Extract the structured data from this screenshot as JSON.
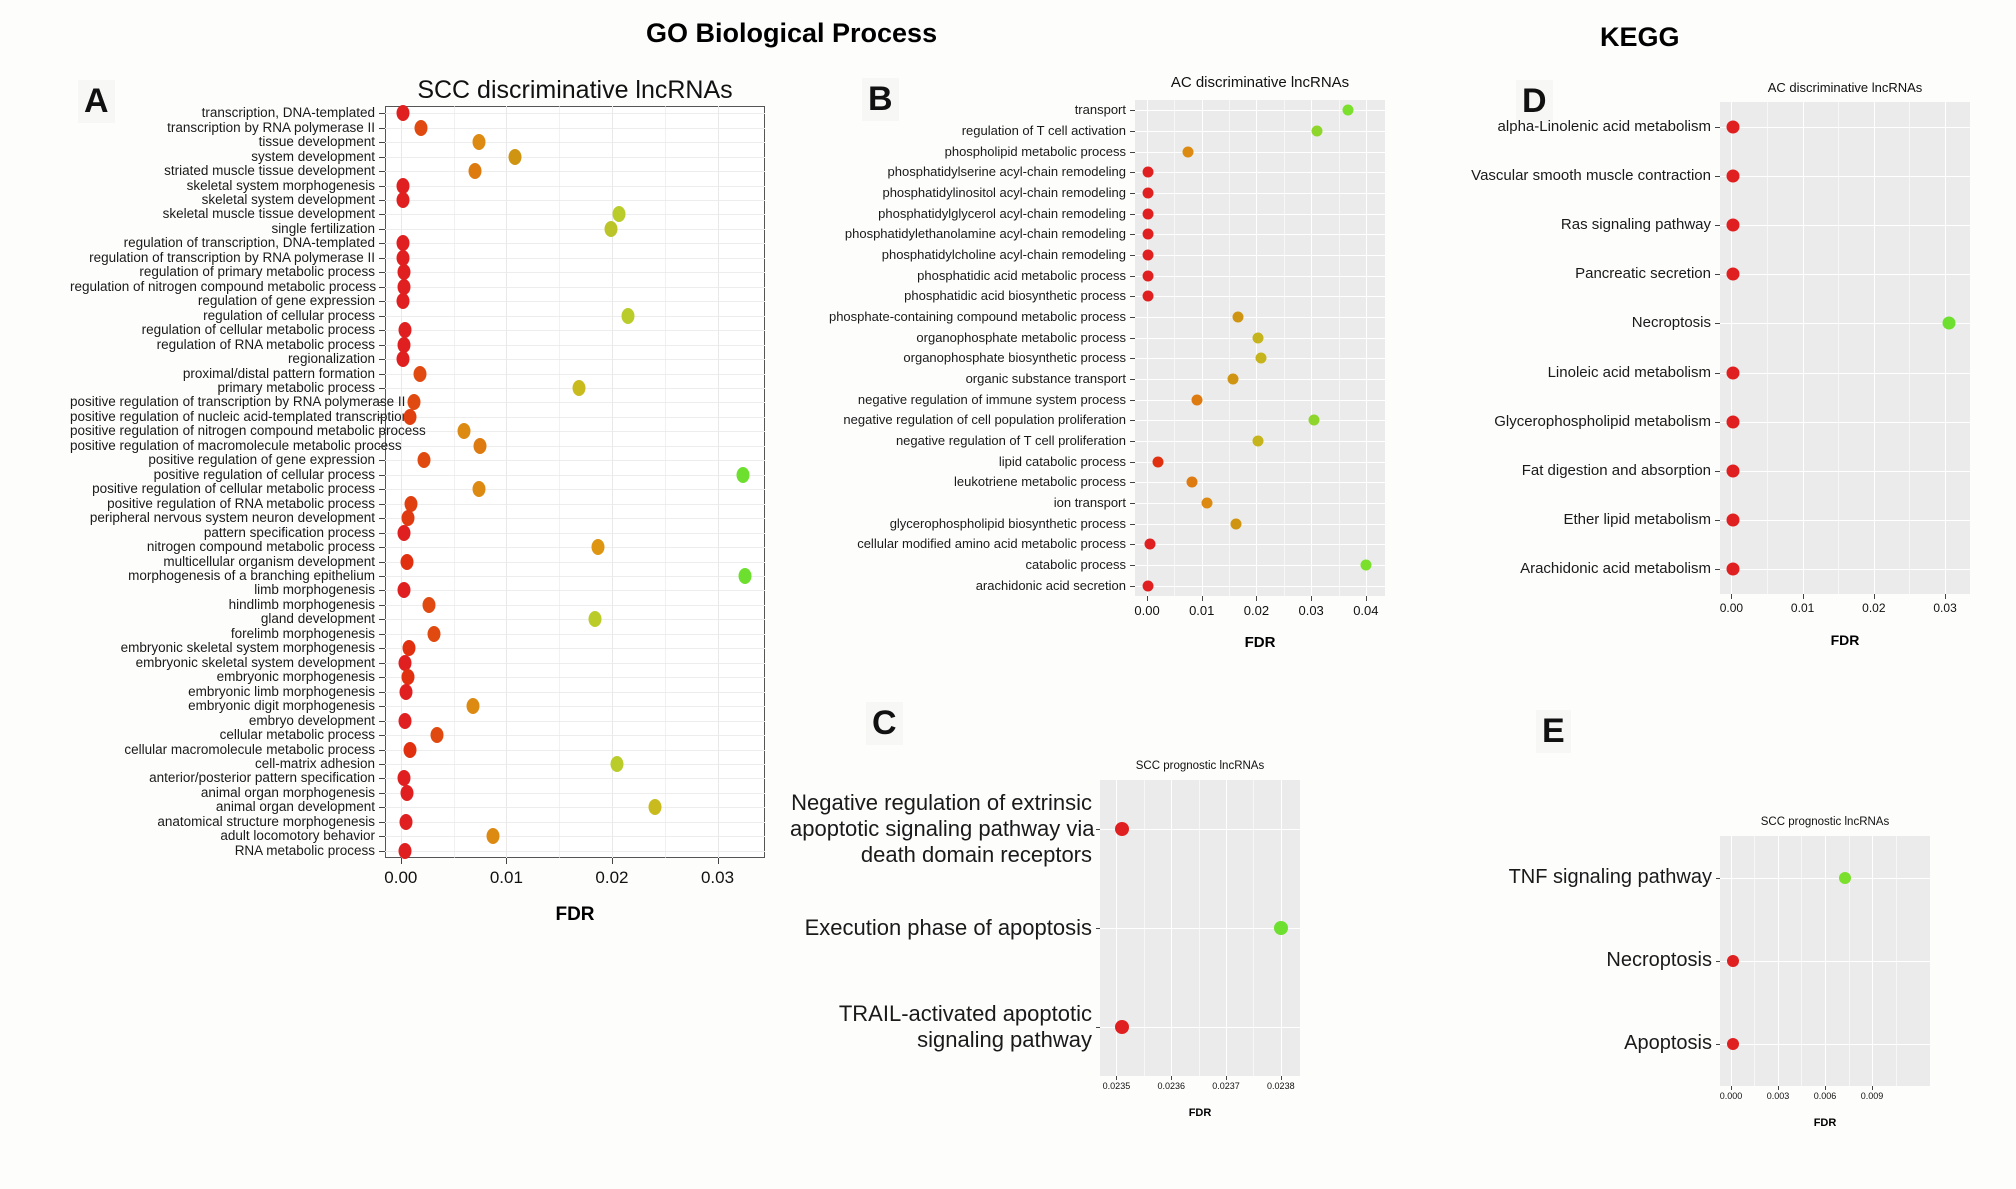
{
  "figure": {
    "suptitles": {
      "go": "GO Biological Process",
      "kegg": "KEGG"
    },
    "panel_letters": {
      "a": "A",
      "b": "B",
      "c": "C",
      "d": "D",
      "e": "E"
    },
    "axis_label": "FDR",
    "colors": {
      "red": "#e02020",
      "orange_red": "#e04a10",
      "orange": "#dd7a10",
      "amber": "#cf9512",
      "olive": "#bbb022",
      "yellow_green": "#b9cc2a",
      "green": "#6ddf2e",
      "bright_green": "#5ef52a",
      "panel_grey": "#ebebeb",
      "grid_white": "#ffffff"
    }
  },
  "chart_data": [
    {
      "id": "A",
      "type": "scatter",
      "title": "SCC discriminative lncRNAs",
      "xlabel": "FDR",
      "ylabel": "",
      "xlim": [
        -0.0015,
        0.0345
      ],
      "xticks": [
        0.0,
        0.01,
        0.02,
        0.03
      ],
      "xtick_labels": [
        "0.00",
        "0.01",
        "0.02",
        "0.03"
      ],
      "grid": true,
      "legend": "none",
      "categories": [
        "transcription, DNA-templated",
        "transcription by RNA polymerase II",
        "tissue development",
        "system development",
        "striated muscle tissue development",
        "skeletal system morphogenesis",
        "skeletal system development",
        "skeletal muscle tissue development",
        "single fertilization",
        "regulation of transcription, DNA-templated",
        "regulation of transcription by RNA polymerase II",
        "regulation of primary metabolic process",
        "regulation of nitrogen compound metabolic process",
        "regulation of gene expression",
        "regulation of cellular process",
        "regulation of cellular metabolic process",
        "regulation of RNA metabolic process",
        "regionalization",
        "proximal/distal pattern formation",
        "primary metabolic process",
        "positive regulation of transcription by RNA polymerase II",
        "positive regulation of nucleic acid-templated transcription",
        "positive regulation of nitrogen compound metabolic process",
        "positive regulation of macromolecule metabolic process",
        "positive regulation of gene expression",
        "positive regulation of cellular process",
        "positive regulation of cellular metabolic process",
        "positive regulation of RNA metabolic process",
        "peripheral nervous system neuron development",
        "pattern specification process",
        "nitrogen compound metabolic process",
        "multicellular organism development",
        "morphogenesis of a branching epithelium",
        "limb morphogenesis",
        "hindlimb morphogenesis",
        "gland development",
        "forelimb morphogenesis",
        "embryonic skeletal system morphogenesis",
        "embryonic skeletal system development",
        "embryonic morphogenesis",
        "embryonic limb morphogenesis",
        "embryonic digit morphogenesis",
        "embryo development",
        "cellular metabolic process",
        "cellular macromolecule metabolic process",
        "cell-matrix adhesion",
        "anterior/posterior pattern specification",
        "animal organ morphogenesis",
        "animal organ development",
        "anatomical structure morphogenesis",
        "adult locomotory behavior",
        "RNA metabolic process"
      ],
      "values": [
        0.0002,
        0.0019,
        0.0074,
        0.0108,
        0.007,
        0.0002,
        0.0002,
        0.0207,
        0.0199,
        0.0002,
        0.0002,
        0.0003,
        0.0003,
        0.0002,
        0.0215,
        0.0004,
        0.0003,
        0.0002,
        0.0018,
        0.0169,
        0.0012,
        0.0009,
        0.006,
        0.0075,
        0.0022,
        0.0324,
        0.0074,
        0.001,
        0.0007,
        0.0003,
        0.0187,
        0.0006,
        0.0326,
        0.0003,
        0.0027,
        0.0184,
        0.0031,
        0.0008,
        0.0004,
        0.0007,
        0.0005,
        0.0068,
        0.0004,
        0.0034,
        0.0009,
        0.0205,
        0.0003,
        0.0006,
        0.0241,
        0.0005,
        0.0087,
        0.0004
      ],
      "point_colors": [
        "#e02020",
        "#e04a10",
        "#dd8a12",
        "#cf9512",
        "#dd7a10",
        "#e02020",
        "#e02020",
        "#b9cc2a",
        "#bbc52a",
        "#e02020",
        "#e02020",
        "#e02020",
        "#e02020",
        "#e02020",
        "#b9cc2a",
        "#e02020",
        "#e02020",
        "#e02020",
        "#e04a10",
        "#c9bb1e",
        "#e04a10",
        "#e04010",
        "#dd8a12",
        "#dd7a10",
        "#e04a10",
        "#6ddf2e",
        "#dd8a12",
        "#e04010",
        "#e03a10",
        "#e02020",
        "#dd9512",
        "#e03010",
        "#6ddf2e",
        "#e02020",
        "#e04a10",
        "#bbcb28",
        "#e04a10",
        "#e03010",
        "#e02020",
        "#e03010",
        "#e02020",
        "#dd8a12",
        "#e02020",
        "#e04a10",
        "#e03010",
        "#b9cc2a",
        "#e02020",
        "#e02020",
        "#c9bb1e",
        "#e02020",
        "#dd8a12",
        "#e02020"
      ]
    },
    {
      "id": "B",
      "type": "scatter",
      "title": "AC discriminative lncRNAs",
      "xlabel": "FDR",
      "xlim": [
        -0.0022,
        0.0435
      ],
      "xticks": [
        0.0,
        0.01,
        0.02,
        0.03,
        0.04
      ],
      "xtick_labels": [
        "0.00",
        "0.01",
        "0.02",
        "0.03",
        "0.04"
      ],
      "grid": true,
      "categories": [
        "transport",
        "regulation of T cell activation",
        "phospholipid metabolic process",
        "phosphatidylserine acyl-chain remodeling",
        "phosphatidylinositol acyl-chain remodeling",
        "phosphatidylglycerol acyl-chain remodeling",
        "phosphatidylethanolamine acyl-chain remodeling",
        "phosphatidylcholine acyl-chain remodeling",
        "phosphatidic acid metabolic process",
        "phosphatidic acid biosynthetic process",
        "phosphate-containing compound metabolic process",
        "organophosphate metabolic process",
        "organophosphate biosynthetic process",
        "organic substance transport",
        "negative regulation of immune system process",
        "negative regulation of cell population proliferation",
        "negative regulation of T cell proliferation",
        "lipid catabolic process",
        "leukotriene metabolic process",
        "ion transport",
        "glycerophospholipid biosynthetic process",
        "cellular modified amino acid metabolic process",
        "catabolic process",
        "arachidonic acid secretion"
      ],
      "values": [
        0.0368,
        0.0311,
        0.0075,
        0.0002,
        0.0002,
        0.0002,
        0.0002,
        0.0002,
        0.0002,
        0.0002,
        0.0166,
        0.0203,
        0.0208,
        0.0158,
        0.0092,
        0.0305,
        0.0202,
        0.002,
        0.0082,
        0.011,
        0.0163,
        0.0005,
        0.04,
        0.0001
      ],
      "point_colors": [
        "#7ae02c",
        "#8fd62c",
        "#dd8a12",
        "#e02020",
        "#e02020",
        "#e02020",
        "#e02020",
        "#e02020",
        "#e02020",
        "#e02020",
        "#cf9512",
        "#c5b41c",
        "#c5b41c",
        "#cf9512",
        "#dd7a10",
        "#8fd62c",
        "#c5b41c",
        "#e03010",
        "#dd7a10",
        "#dd8a12",
        "#cf9512",
        "#e02020",
        "#7ae02c",
        "#e02020"
      ]
    },
    {
      "id": "C",
      "type": "scatter",
      "title": "SCC prognostic lncRNAs",
      "xlabel": "FDR",
      "xlim": [
        0.02347,
        0.023835
      ],
      "xticks": [
        0.0235,
        0.0236,
        0.0237,
        0.0238
      ],
      "xtick_labels": [
        "0.0235",
        "0.0236",
        "0.0237",
        "0.0238"
      ],
      "grid": true,
      "categories": [
        "Negative regulation of extrinsic apoptotic signaling pathway via death domain receptors",
        "Execution phase of apoptosis",
        "TRAIL-activated apoptotic signaling pathway"
      ],
      "category_lines": [
        [
          "Negative regulation of extrinsic",
          "apoptotic signaling pathway via",
          "death domain receptors"
        ],
        [
          "Execution phase of apoptosis"
        ],
        [
          "TRAIL-activated apoptotic",
          "signaling pathway"
        ]
      ],
      "values": [
        0.02351,
        0.0238,
        0.02351
      ],
      "point_colors": [
        "#e02020",
        "#6ddf2e",
        "#e02020"
      ]
    },
    {
      "id": "D",
      "type": "scatter",
      "title": "AC discriminative lncRNAs",
      "xlabel": "FDR",
      "xlim": [
        -0.0016,
        0.0335
      ],
      "xticks": [
        0.0,
        0.01,
        0.02,
        0.03
      ],
      "xtick_labels": [
        "0.00",
        "0.01",
        "0.02",
        "0.03"
      ],
      "grid": true,
      "categories": [
        "alpha-Linolenic acid metabolism",
        "Vascular smooth muscle contraction",
        "Ras signaling pathway",
        "Pancreatic secretion",
        "Necroptosis",
        "Linoleic acid metabolism",
        "Glycerophospholipid metabolism",
        "Fat digestion and absorption",
        "Ether lipid metabolism",
        "Arachidonic acid metabolism"
      ],
      "values": [
        0.0002,
        0.0002,
        0.0002,
        0.0002,
        0.0306,
        0.0002,
        0.0002,
        0.0002,
        0.0002,
        0.0002
      ],
      "point_colors": [
        "#e02020",
        "#e02020",
        "#e02020",
        "#e02020",
        "#6ddf2e",
        "#e02020",
        "#e02020",
        "#e02020",
        "#e02020",
        "#e02020"
      ]
    },
    {
      "id": "E",
      "type": "scatter",
      "title": "SCC prognostic lncRNAs",
      "xlabel": "FDR",
      "xlim": [
        -0.0007,
        0.0127
      ],
      "xticks": [
        0.0,
        0.003,
        0.006,
        0.009
      ],
      "xtick_labels": [
        "0.000",
        "0.003",
        "0.006",
        "0.009"
      ],
      "grid": true,
      "categories": [
        "TNF signaling pathway",
        "Necroptosis",
        "Apoptosis"
      ],
      "values": [
        0.0073,
        0.0001,
        0.0001
      ],
      "point_colors": [
        "#7ae02c",
        "#e02020",
        "#e02020"
      ]
    }
  ]
}
